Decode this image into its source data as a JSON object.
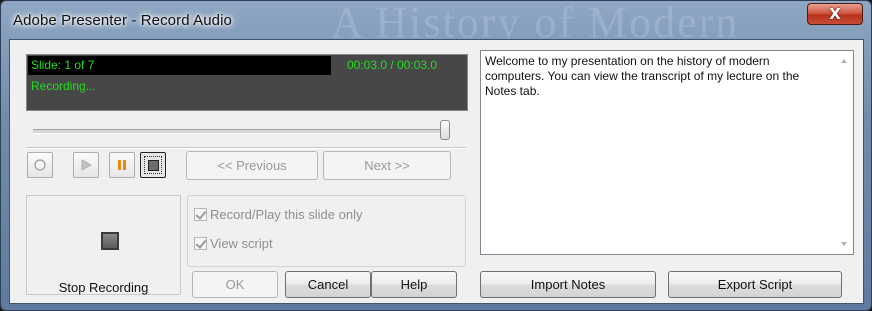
{
  "window": {
    "title": "Adobe Presenter - Record Audio",
    "background_title": "A History of Modern",
    "close_glyph": "X"
  },
  "display": {
    "slide": "Slide: 1 of 7",
    "time": "00:03.0 / 00:03.0",
    "status": "Recording..."
  },
  "slider": {
    "position_fraction": 0.99
  },
  "transport": {
    "record_icon": "record-icon",
    "play_icon": "play-icon",
    "pause_icon": "pause-icon",
    "stop_icon": "stop-icon"
  },
  "nav": {
    "previous": "<< Previous",
    "next": "Next >>"
  },
  "stop_recording": {
    "label": "Stop Recording"
  },
  "options": {
    "record_play_this_slide_only": {
      "label": "Record/Play this slide only",
      "checked": true
    },
    "view_script": {
      "label": "View script",
      "checked": true
    }
  },
  "buttons": {
    "ok": "OK",
    "cancel": "Cancel",
    "help": "Help",
    "import_notes": "Import Notes",
    "export_script": "Export Script"
  },
  "script": {
    "text": "Welcome to my presentation on the history of modern computers.  You can view the transcript of my lecture on the Notes tab."
  },
  "colors": {
    "display_text": "#22dd22",
    "pause_icon": "#e88a10",
    "close_button": "#c94d36"
  }
}
